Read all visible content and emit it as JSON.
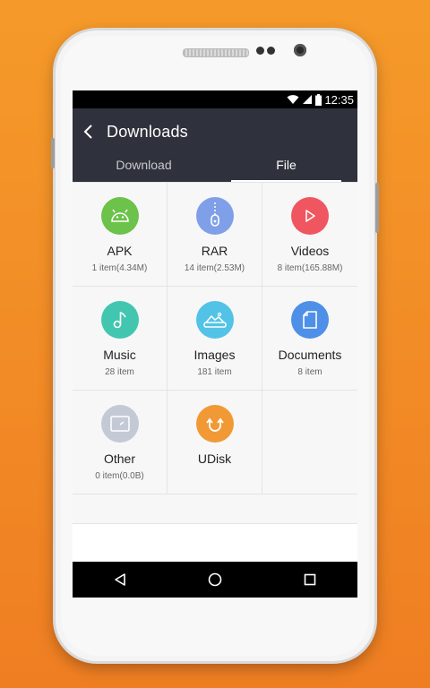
{
  "status_bar": {
    "time": "12:35"
  },
  "app_bar": {
    "title": "Downloads"
  },
  "tabs": [
    {
      "label": "Download",
      "active": false
    },
    {
      "label": "File",
      "active": true
    }
  ],
  "categories": [
    {
      "label": "APK",
      "count": "1  item(4.34M)",
      "icon": "android-icon",
      "color": "#6cc24a"
    },
    {
      "label": "RAR",
      "count": "14  item(2.53M)",
      "icon": "zipper-icon",
      "color": "#7f9fe8"
    },
    {
      "label": "Videos",
      "count": "8  item(165.88M)",
      "icon": "play-icon",
      "color": "#f0565f"
    },
    {
      "label": "Music",
      "count": "28  item",
      "icon": "music-note-icon",
      "color": "#43c6b0"
    },
    {
      "label": "Images",
      "count": "181  item",
      "icon": "landscape-icon",
      "color": "#52c3e6"
    },
    {
      "label": "Documents",
      "count": "8  item",
      "icon": "document-icon",
      "color": "#4e8fe8"
    },
    {
      "label": "Other",
      "count": "0  item(0.0B)",
      "icon": "folder-icon",
      "color": "#c4c9d6"
    },
    {
      "label": "UDisk",
      "count": "",
      "icon": "usb-icon",
      "color": "#f19a35"
    }
  ]
}
